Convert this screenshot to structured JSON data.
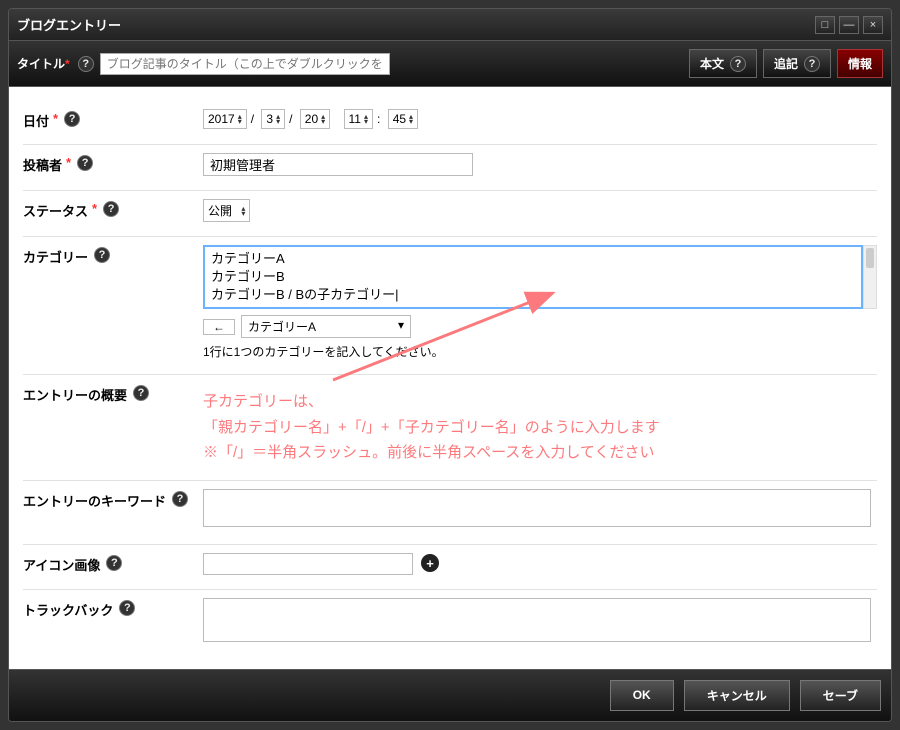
{
  "window_title": "ブログエントリー",
  "toolbar": {
    "title_label": "タイトル",
    "title_placeholder": "ブログ記事のタイトル（この上でダブルクリックをし",
    "body_btn": "本文",
    "append_btn": "追記",
    "info_btn": "情報"
  },
  "rows": {
    "date_label": "日付",
    "date": {
      "year": "2017",
      "month": "3",
      "day": "20",
      "hour": "11",
      "minute": "45"
    },
    "author_label": "投稿者",
    "author_value": "初期管理者",
    "status_label": "ステータス",
    "status_value": "公開",
    "category_label": "カテゴリー",
    "category_text": "カテゴリーA\nカテゴリーB\nカテゴリーB / Bの子カテゴリー|",
    "category_arrow": "←",
    "category_select": "カテゴリーA",
    "category_hint": "1行に1つのカテゴリーを記入してください。",
    "summary_label": "エントリーの概要",
    "keywords_label": "エントリーのキーワード",
    "icon_label": "アイコン画像",
    "trackback_label": "トラックバック"
  },
  "annotation": {
    "line1": "子カテゴリーは、",
    "line2": "「親カテゴリー名」+「/」+「子カテゴリー名」のように入力します",
    "line3": "※「/」＝半角スラッシュ。前後に半角スペースを入力してください"
  },
  "footer": {
    "ok": "OK",
    "cancel": "キャンセル",
    "save": "セーブ"
  }
}
